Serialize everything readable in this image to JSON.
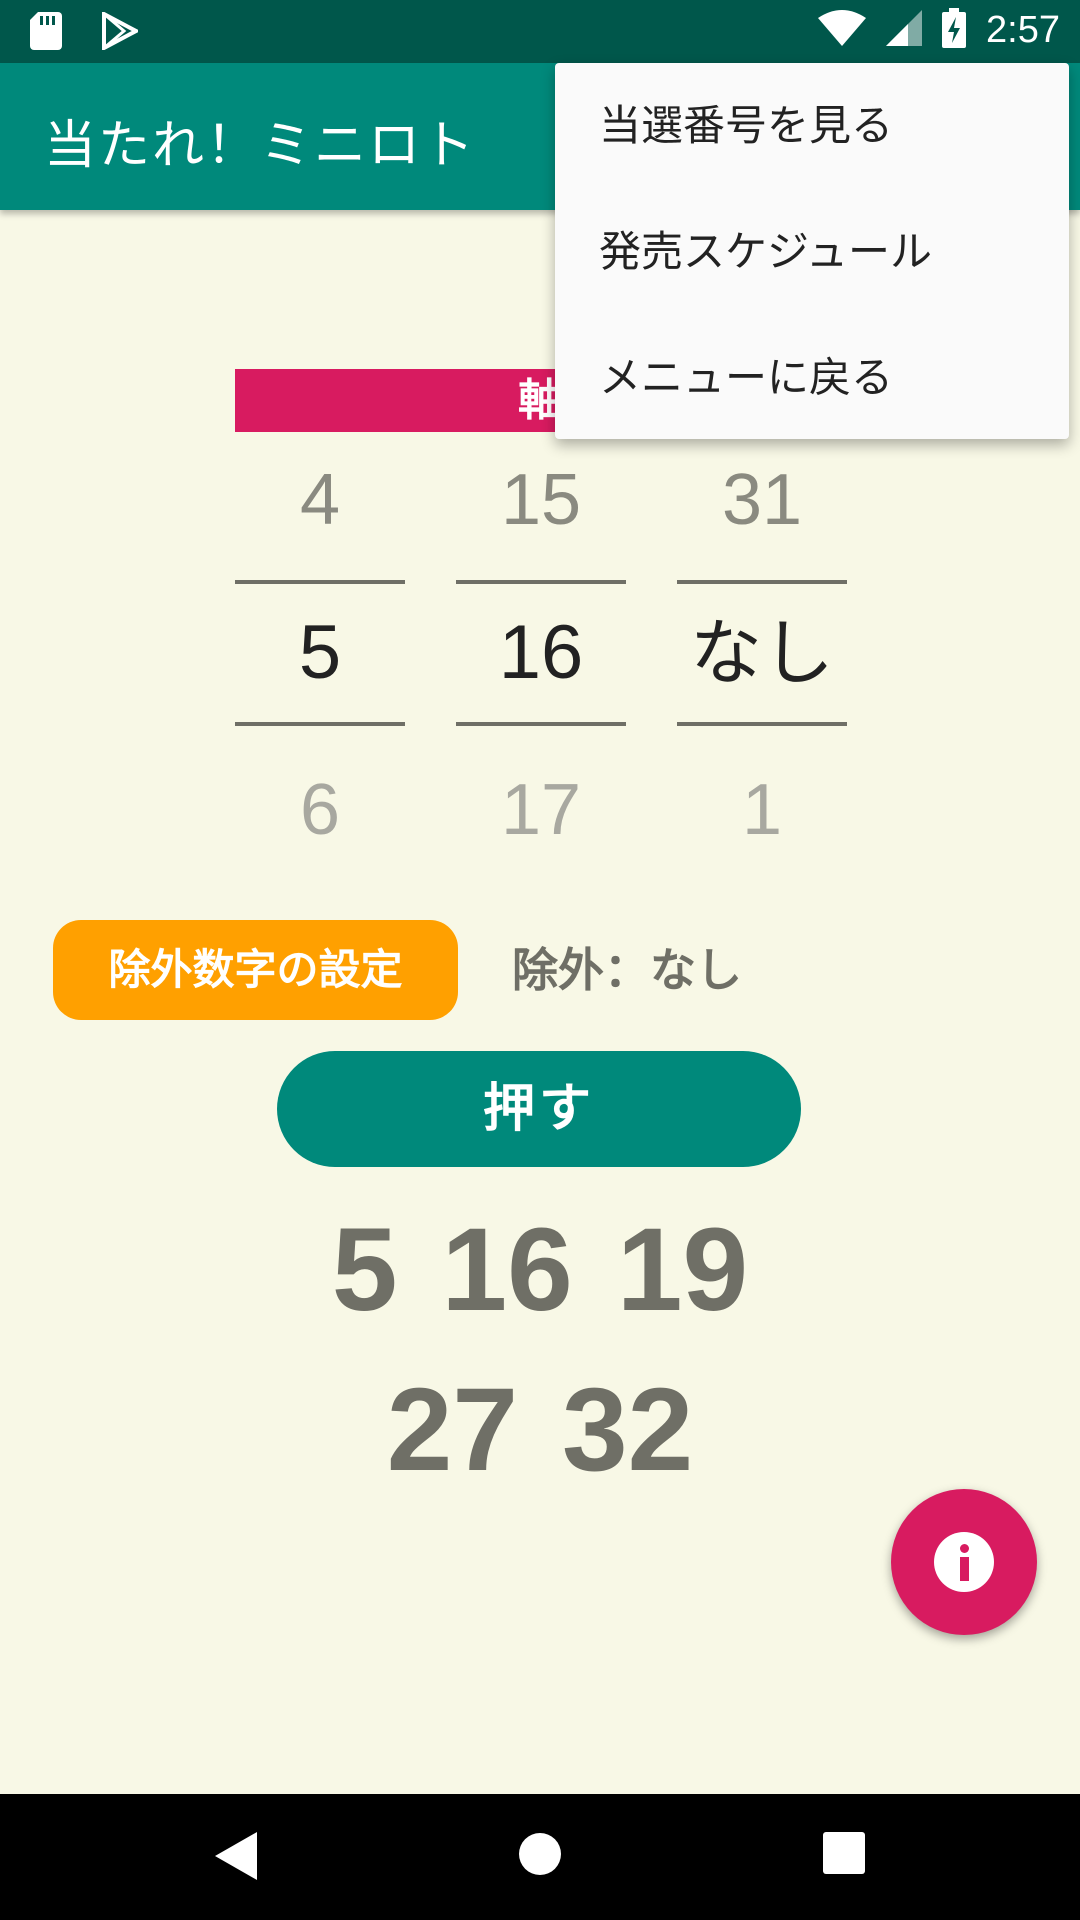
{
  "status_bar": {
    "time": "2:57",
    "left_icons": [
      "sd-card-icon",
      "play-store-icon"
    ],
    "right_icons": [
      "wifi-icon",
      "cell-signal-icon",
      "battery-charging-icon"
    ]
  },
  "app_bar": {
    "title": "当たれ！ミニロト"
  },
  "main": {
    "header_label": "軸",
    "pickers": [
      {
        "above": "4",
        "selected": "5",
        "below": "6"
      },
      {
        "above": "15",
        "selected": "16",
        "below": "17"
      },
      {
        "above": "31",
        "selected": "なし",
        "below": "1"
      }
    ],
    "exclude_button": "除外数字の設定",
    "exclude_label": "除外：なし",
    "push_button": "押す",
    "results": [
      [
        "5",
        "16",
        "19"
      ],
      [
        "27",
        "32"
      ]
    ]
  },
  "overflow_menu": {
    "items": [
      "当選番号を見る",
      "発売スケジュール",
      "メニューに戻る"
    ]
  },
  "fab": {
    "icon": "info-icon"
  },
  "nav_bar": {
    "icons": [
      "back-icon",
      "home-icon",
      "recents-icon"
    ]
  },
  "colors": {
    "status_bar": "#00574b",
    "app_bar": "#00897b",
    "accent_pink": "#d81b60",
    "orange": "#ffa000",
    "background": "#f8f8e6"
  }
}
